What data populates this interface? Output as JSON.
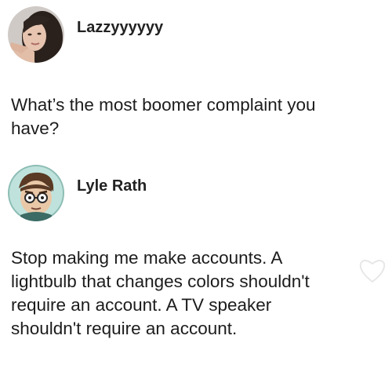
{
  "question_post": {
    "author_name": "Lazzyyyyyy",
    "avatar_icon": "profile-photo-icon",
    "text": "What’s the most boomer complaint you\nhave?"
  },
  "answer_post": {
    "author_name": "Lyle Rath",
    "avatar_icon": "cartoon-avatar-icon",
    "text": "Stop making me make accounts. A\nlightbulb that changes colors shouldn't\nrequire an account. A TV speaker\nshouldn't require an account."
  },
  "colors": {
    "background": "#ffffff",
    "text": "#1c1c1c"
  }
}
